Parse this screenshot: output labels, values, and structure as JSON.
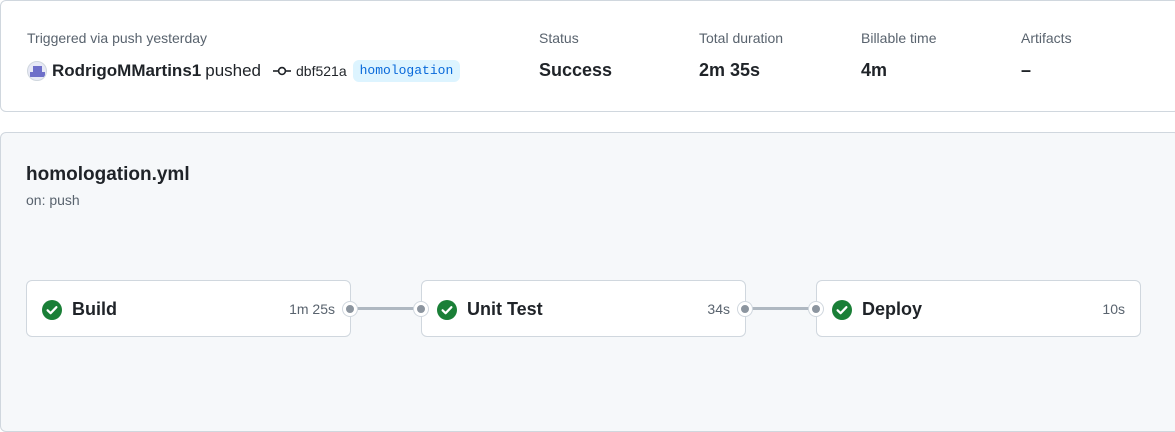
{
  "summary": {
    "trigger_text": "Triggered via push yesterday",
    "actor": "RodrigoMMartins1",
    "action": "pushed",
    "commit_sha": "dbf521a",
    "branch": "homologation",
    "status_label": "Status",
    "status_value": "Success",
    "duration_label": "Total duration",
    "duration_value": "2m 35s",
    "billable_label": "Billable time",
    "billable_value": "4m",
    "artifacts_label": "Artifacts",
    "artifacts_value": "–"
  },
  "workflow": {
    "file": "homologation.yml",
    "trigger": "on: push",
    "jobs": [
      {
        "name": "Build",
        "duration": "1m 25s",
        "status": "success"
      },
      {
        "name": "Unit Test",
        "duration": "34s",
        "status": "success"
      },
      {
        "name": "Deploy",
        "duration": "10s",
        "status": "success"
      }
    ]
  },
  "colors": {
    "success": "#1a7f37",
    "branch_fg": "#0969da",
    "branch_bg": "#ddf4ff",
    "muted": "#59636e",
    "graph_bg": "#f6f8fa"
  },
  "icons": {
    "commit": "git-commit-icon",
    "job_status": "check-circle-fill-icon"
  }
}
